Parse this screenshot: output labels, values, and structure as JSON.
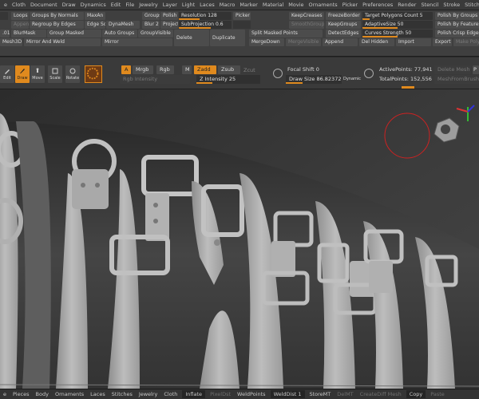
{
  "menu": [
    "e",
    "Cloth",
    "Document",
    "Draw",
    "Dynamics",
    "Edit",
    "File",
    "Jewelry",
    "Layer",
    "Light",
    "Laces",
    "Macro",
    "Marker",
    "Material",
    "Movie",
    "Ornaments",
    "Picker",
    "Preferences",
    "Render",
    "Stencil",
    "Stroke",
    "Stitches",
    "Texture",
    "Tool",
    "T"
  ],
  "palette": {
    "loops": "Loops",
    "groups_by_normals": "Groups By Normals",
    "maxan": "MaxAn",
    "appendol": "Append",
    "regroup_by_edges": "Regroup By Edges",
    "edge_sc": "Edge Sc",
    "dynamesh": "DynaMesh",
    "groups": "Groups",
    "polish": "Polish",
    "blur": "Blur 2",
    "project": "Project",
    "resolution": "Resolution 128",
    "subprojection": "SubProjection 0.6",
    "picker": "Picker",
    "keepcreases": "KeepCreases",
    "smoothgroups": "SmoothGroups",
    "zremesher": "ZRemesher",
    "freezeborder": "FreezeBorder",
    "keepgroups": "KeepGroups",
    "target_polygons": "Target Polygons Count 5",
    "adaptivesize": "AdaptiveSize 50",
    "curves_strength": "Curves Strength 50",
    "detectedges": "DetectEdges",
    "polish_by_groups": "Polish By Groups",
    "polish_by_features": "Polish By Features",
    "polish_crisp_edges": "Polish Crisp Edges",
    "val_01": ".01",
    "blurmask": "BlurMask",
    "group_masked": "Group Masked",
    "auto_groups": "Auto Groups",
    "groupvisible": "GroupVisible",
    "delete": "Delete",
    "duplicate": "Duplicate",
    "split_masked": "Split Masked Points",
    "mesh3d": "Mesh3D",
    "mirror_and_weld": "Mirror And Weld",
    "mirror": "Mirror",
    "mergedown": "MergeDown",
    "mergevisible": "MergeVisible",
    "append": "Append",
    "del_hidden": "Del Hidden",
    "import": "Import",
    "export": "Export",
    "make_polymesh": "Make Polym"
  },
  "shelf": {
    "tools": [
      {
        "label": "Edit",
        "icon": "edit-icon",
        "active": false
      },
      {
        "label": "Draw",
        "icon": "draw-icon",
        "active": true
      },
      {
        "label": "Move",
        "icon": "move-icon",
        "active": false
      },
      {
        "label": "Scale",
        "icon": "scale-icon",
        "active": false
      },
      {
        "label": "Rotate",
        "icon": "rotate-icon",
        "active": false
      }
    ],
    "a": "A",
    "mrgb": "Mrgb",
    "rgb": "Rgb",
    "m": "M",
    "zadd": "Zadd",
    "zsub": "Zsub",
    "zcut": "Zcut",
    "rgb_intensity": "Rgb Intensity",
    "z_intensity": "Z Intensity 25",
    "z_intensity_value": 25,
    "focal_shift": "Focal Shift 0",
    "draw_size": "Draw Size 86.82372",
    "dynamic": "Dynamic",
    "active_points": "ActivePoints: 77,941",
    "total_points": "TotalPoints: 152,556",
    "delete_mesh": "Delete Mesh",
    "mesh_from_brush": "MeshFromBrush",
    "p": "P"
  },
  "bottom": [
    "e",
    "Pieces",
    "Body",
    "Ornaments",
    "Laces",
    "Stitches",
    "Jewelry",
    "Cloth",
    "Inflate",
    "PixelDst",
    "WeldPoints",
    "WeldDist 1",
    "StoreMT",
    "DelMT",
    "CreateDiff Mesh",
    "Copy",
    "Paste"
  ],
  "colors": {
    "accent": "#e08a1e",
    "panel": "#3f3f3f",
    "viewport": "#383838",
    "strap": "#a8a8a8"
  }
}
